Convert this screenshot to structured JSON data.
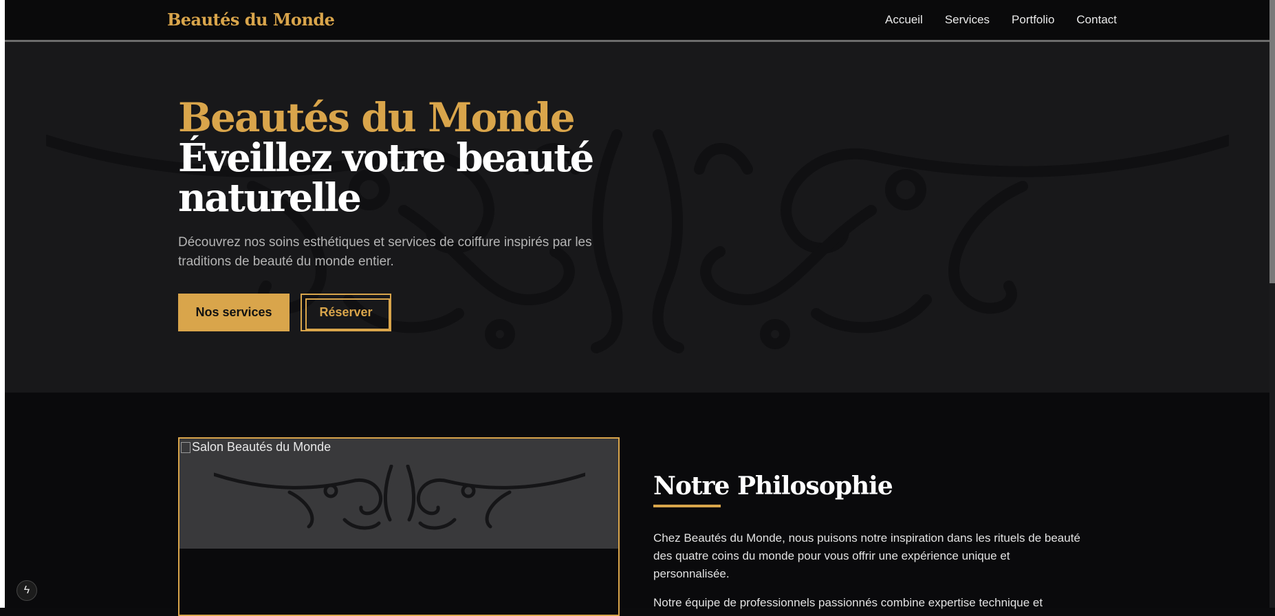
{
  "nav": {
    "brand": "Beautés du Monde",
    "links": [
      "Accueil",
      "Services",
      "Portfolio",
      "Contact"
    ]
  },
  "hero": {
    "brand": "Beautés du Monde",
    "title": "Éveillez votre beauté naturelle",
    "text": "Découvrez nos soins esthétiques et services de coiffure inspirés par les traditions de beauté du monde entier.",
    "primary_button": "Nos services",
    "secondary_button": "Réserver"
  },
  "about": {
    "image_alt": "Salon Beautés du Monde",
    "title": "Notre Philosophie",
    "paragraph1": "Chez Beautés du Monde, nous puisons notre inspiration dans les rituels de beauté des quatre coins du monde pour vous offrir une expérience unique et personnalisée.",
    "paragraph2": "Notre équipe de professionnels passionnés combine expertise technique et"
  },
  "badge": {
    "icon": "lightning-icon",
    "symbol": "ϟ"
  },
  "colors": {
    "accent": "#d9a54b",
    "background": "#0b0b0d",
    "hero_background": "#18181a",
    "text": "#ffffff"
  }
}
